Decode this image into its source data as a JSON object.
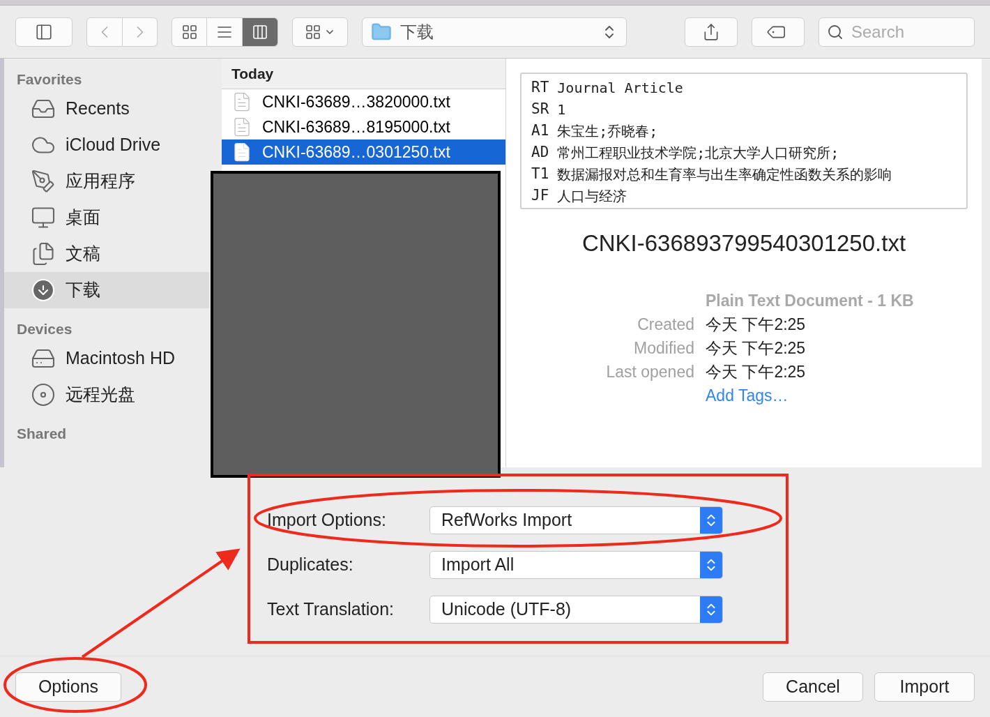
{
  "toolbar": {
    "view_modes": [
      {
        "kind": "icons",
        "selected": false
      },
      {
        "kind": "list",
        "selected": false
      },
      {
        "kind": "columns",
        "selected": true
      }
    ],
    "location": "下载",
    "search": {
      "placeholder": "Search"
    }
  },
  "sidebar": {
    "sections": [
      {
        "title": "Favorites",
        "items": [
          {
            "kind": "recents",
            "label": "Recents",
            "selected": false
          },
          {
            "kind": "cloud",
            "label": "iCloud Drive",
            "selected": false
          },
          {
            "kind": "apps",
            "label": "应用程序",
            "selected": false
          },
          {
            "kind": "desktop",
            "label": "桌面",
            "selected": false
          },
          {
            "kind": "documents",
            "label": "文稿",
            "selected": false
          },
          {
            "kind": "downloads",
            "label": "下载",
            "selected": true
          }
        ]
      },
      {
        "title": "Devices",
        "items": [
          {
            "kind": "disk",
            "label": "Macintosh HD",
            "selected": false
          },
          {
            "kind": "disc",
            "label": "远程光盘",
            "selected": false
          }
        ]
      },
      {
        "title": "Shared"
      }
    ]
  },
  "column": {
    "header": "Today",
    "files": [
      {
        "name": "CNKI-63689…3820000.txt",
        "selected": false
      },
      {
        "name": "CNKI-63689…8195000.txt",
        "selected": false
      },
      {
        "name": "CNKI-63689…0301250.txt",
        "selected": true
      }
    ]
  },
  "preview": {
    "lines": [
      {
        "tag": "RT",
        "text": "Journal Article"
      },
      {
        "tag": "SR",
        "text": "1"
      },
      {
        "tag": "A1",
        "text": "朱宝生;乔晓春;"
      },
      {
        "tag": "AD",
        "text": "常州工程职业技术学院;北京大学人口研究所;"
      },
      {
        "tag": "T1",
        "text": "数据漏报对总和生育率与出生率确定性函数关系的影响"
      },
      {
        "tag": "JF",
        "text": "人口与经济"
      }
    ],
    "filename": "CNKI-636893799540301250.txt",
    "kind_size": "Plain Text Document - 1 KB",
    "info": [
      {
        "label": "Created",
        "value": "今天 下午2:25"
      },
      {
        "label": "Modified",
        "value": "今天 下午2:25"
      },
      {
        "label": "Last opened",
        "value": "今天 下午2:25"
      }
    ],
    "add_tags": "Add Tags…"
  },
  "options": [
    {
      "label": "Import Options:",
      "value": "RefWorks Import"
    },
    {
      "label": "Duplicates:",
      "value": "Import All"
    },
    {
      "label": "Text Translation:",
      "value": "Unicode (UTF-8)"
    }
  ],
  "buttons": {
    "options": "Options",
    "cancel": "Cancel",
    "import": "Import"
  }
}
